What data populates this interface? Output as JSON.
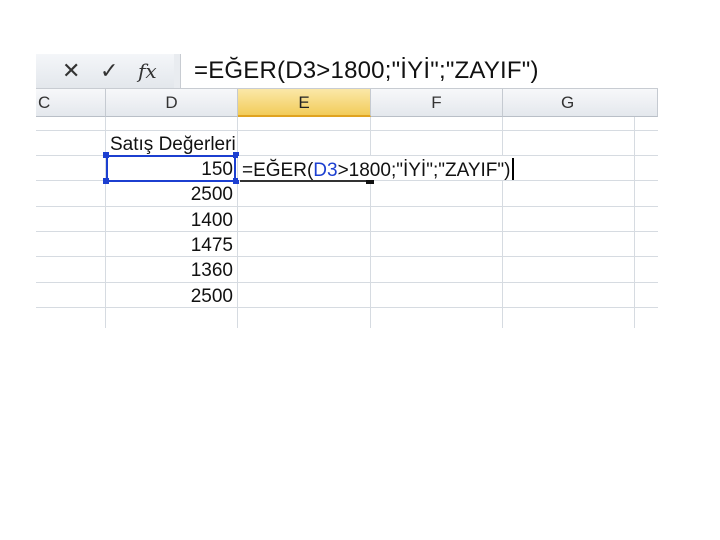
{
  "formula_bar": {
    "cancel_icon": "x-icon",
    "enter_icon": "check-icon",
    "fx_label": "fx",
    "formula": "=EĞER(D3>1800;\"İYİ\";\"ZAYIF\")"
  },
  "columns": [
    "C",
    "D",
    "E",
    "F",
    "G"
  ],
  "active_column": "E",
  "header_cell": "Satış Değerleri",
  "values": [
    "150",
    "2500",
    "1400",
    "1475",
    "1360",
    "2500"
  ],
  "edit": {
    "prefix": "=EĞER(",
    "ref": "D3",
    "suffix": ">1800;\"İYİ\";\"ZAYIF\")"
  },
  "colors": {
    "reference_highlight": "#1c3fd0",
    "active_header": "#f2cc5a"
  }
}
